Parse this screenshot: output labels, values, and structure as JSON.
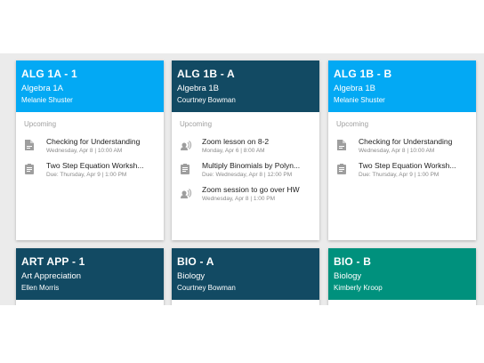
{
  "colors": {
    "light_blue": "#03a9f4",
    "dark_teal": "#124a63",
    "green_teal": "#00917d",
    "icon_grey": "#9e9e9e"
  },
  "cards": [
    {
      "title": "ALG 1A - 1",
      "subtitle": "Algebra 1A",
      "teacher": "Melanie Shuster",
      "upcoming_label": "Upcoming",
      "items": [
        {
          "icon": "document-icon",
          "title": "Checking for Understanding",
          "meta": "Wednesday, Apr 8 | 10:00 AM"
        },
        {
          "icon": "assignment-icon",
          "title": "Two Step Equation Worksh...",
          "meta": "Due: Thursday, Apr 9 | 1:00 PM"
        }
      ]
    },
    {
      "title": "ALG 1B - A",
      "subtitle": "Algebra 1B",
      "teacher": "Courtney Bowman",
      "upcoming_label": "Upcoming",
      "items": [
        {
          "icon": "speaker-icon",
          "title": "Zoom lesson on 8-2",
          "meta": "Monday, Apr 6 | 8:00 AM"
        },
        {
          "icon": "assignment-icon",
          "title": "Multiply Binomials by Polyn...",
          "meta": "Due: Wednesday, Apr 8 | 12:00 PM"
        },
        {
          "icon": "speaker-icon",
          "title": "Zoom session to go over HW",
          "meta": "Wednesday, Apr 8 | 1:00 PM"
        }
      ]
    },
    {
      "title": "ALG 1B - B",
      "subtitle": "Algebra 1B",
      "teacher": "Melanie Shuster",
      "upcoming_label": "Upcoming",
      "items": [
        {
          "icon": "document-icon",
          "title": "Checking for Understanding",
          "meta": "Wednesday, Apr 8 | 10:00 AM"
        },
        {
          "icon": "assignment-icon",
          "title": "Two Step Equation Worksh...",
          "meta": "Due: Thursday, Apr 9 | 1:00 PM"
        }
      ]
    },
    {
      "title": "ART APP - 1",
      "subtitle": "Art Appreciation",
      "teacher": "Ellen Morris"
    },
    {
      "title": "BIO - A",
      "subtitle": "Biology",
      "teacher": "Courtney Bowman"
    },
    {
      "title": "BIO - B",
      "subtitle": "Biology",
      "teacher": "Kimberly Kroop"
    }
  ]
}
